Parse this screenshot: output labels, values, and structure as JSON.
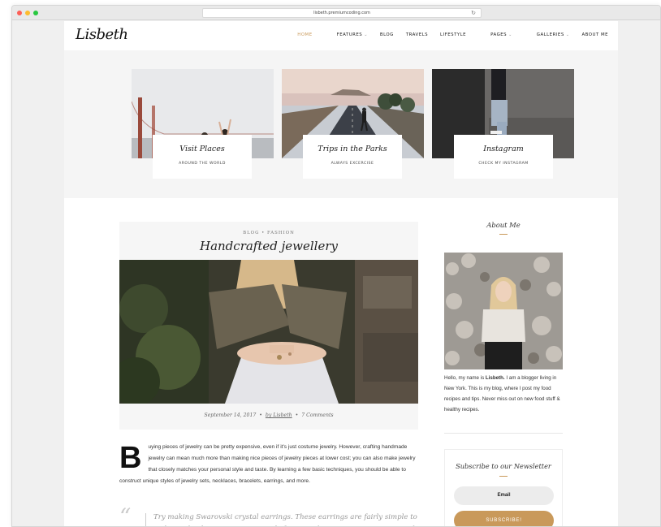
{
  "browser": {
    "url": "lisbeth.premiumcoding.com",
    "dots": [
      "#fd5f57",
      "#fdbc2e",
      "#28c840"
    ],
    "reload_icon": "reload-icon"
  },
  "site": {
    "logo": "Lisbeth",
    "nav": [
      {
        "label": "HOME",
        "active": true,
        "has_dropdown": false
      },
      {
        "label": "FEATURES",
        "active": false,
        "has_dropdown": true
      },
      {
        "label": "BLOG",
        "active": false,
        "has_dropdown": false
      },
      {
        "label": "TRAVELS",
        "active": false,
        "has_dropdown": false
      },
      {
        "label": "LIFESTYLE",
        "active": false,
        "has_dropdown": false
      },
      {
        "label": "PAGES",
        "active": false,
        "has_dropdown": true
      },
      {
        "label": "GALLERIES",
        "active": false,
        "has_dropdown": true
      },
      {
        "label": "ABOUT ME",
        "active": false,
        "has_dropdown": false
      }
    ],
    "accent_color": "#c9995a"
  },
  "features": [
    {
      "title": "Visit Places",
      "subtitle": "AROUND THE WORLD"
    },
    {
      "title": "Trips in the Parks",
      "subtitle": "ALWAYS EXCERCISE"
    },
    {
      "title": "Instagram",
      "subtitle": "CHECK MY INSTAGRAM"
    }
  ],
  "post": {
    "categories": "BLOG • FASHION",
    "title": "Handcrafted jewellery",
    "date": "September 14, 2017",
    "author": "by Lisbeth",
    "comments": "7 Comments",
    "dropcap": "B",
    "body": "uying pieces of jewelry can be pretty expensive, even if it's just costume jewelry. However, crafting handmade jewelry can mean much more than making nice pieces of jewelry pieces at lower cost; you can also make jewelry that closely matches your personal style and taste. By learning a few basic techniques, you should be able to construct unique styles of jewelry sets, necklaces, bracelets, earrings, and more.",
    "quote": "Try making Swarovski crystal earrings. These earrings are fairly simple to make, and only require two crystals for your charms, two jump rings, and two"
  },
  "sidebar": {
    "about_heading": "About Me",
    "about_pre": "Hello, my name is ",
    "about_name": "Lisbeth.",
    "about_post": " I am a blogger living in New York. This is my blog, where I post my food recipes and tips. Never miss out on new food stuff & healthy recipes.",
    "newsletter_heading": "Subscribe to our Newsletter",
    "email_placeholder": "Email",
    "subscribe_label": "SUBSCRIBE!"
  }
}
